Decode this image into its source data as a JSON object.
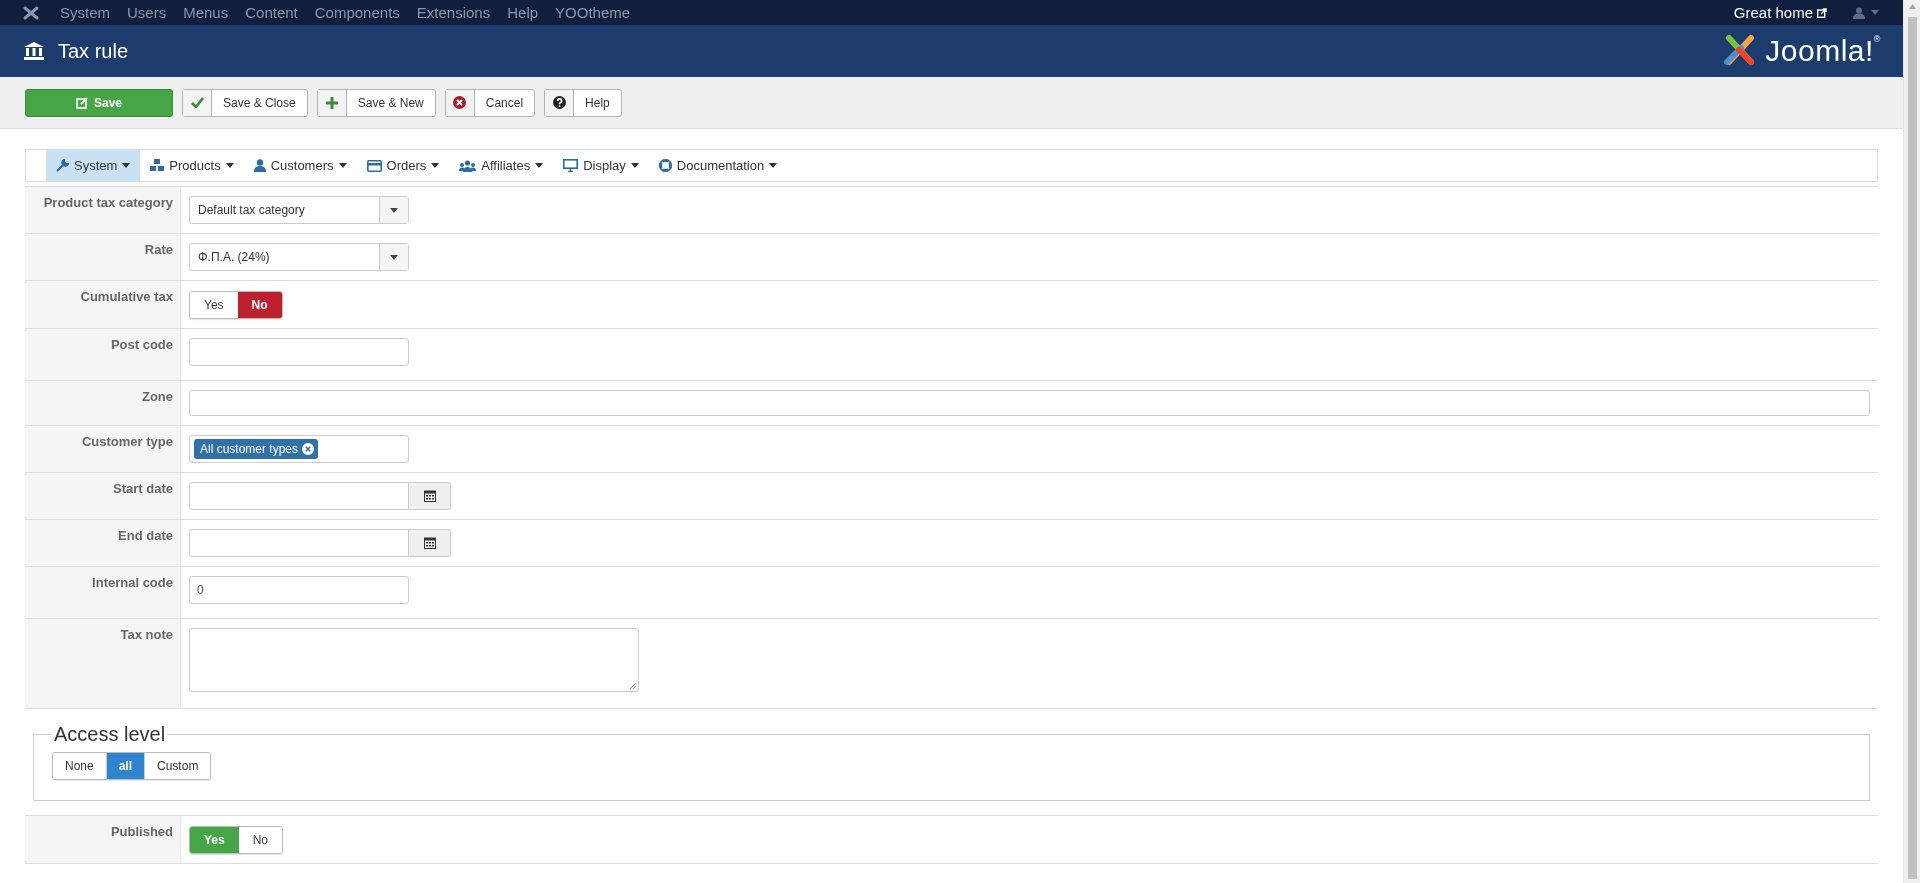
{
  "top_menu": {
    "items": [
      "System",
      "Users",
      "Menus",
      "Content",
      "Components",
      "Extensions",
      "Help",
      "YOOtheme"
    ],
    "site_link": "Great home"
  },
  "header": {
    "title": "Tax rule",
    "logo_text": "Joomla!$^{®}$"
  },
  "toolbar": {
    "buttons": [
      {
        "label": "Save",
        "kind": "primary"
      },
      {
        "label": "Save & Close",
        "kind": "check"
      },
      {
        "label": "Save & New",
        "kind": "plus"
      },
      {
        "label": "Cancel",
        "kind": "cancel"
      },
      {
        "label": "Help",
        "kind": "help"
      }
    ]
  },
  "submenu": {
    "items": [
      {
        "label": "System",
        "selected": true
      },
      {
        "label": "Products",
        "selected": false
      },
      {
        "label": "Customers",
        "selected": false
      },
      {
        "label": "Orders",
        "selected": false
      },
      {
        "label": "Affiliates",
        "selected": false
      },
      {
        "label": "Display",
        "selected": false
      },
      {
        "label": "Documentation",
        "selected": false
      }
    ]
  },
  "form": {
    "fields": [
      {
        "label": "Product tax category",
        "kind": "select",
        "value": "Default tax category"
      },
      {
        "label": "Rate",
        "kind": "select",
        "value": "Φ.Π.Α. (24%)"
      },
      {
        "label": "Cumulative tax",
        "kind": "toggle",
        "options": [
          {
            "label": "Yes",
            "selected": false
          },
          {
            "label": "No",
            "selected": true
          }
        ]
      },
      {
        "label": "Post code",
        "kind": "text"
      },
      {
        "label": "Zone",
        "kind": "multiselect"
      },
      {
        "label": "Customer type",
        "kind": "tags",
        "tags": [
          "All customer types"
        ]
      },
      {
        "label": "Start date",
        "kind": "date"
      },
      {
        "label": "End date",
        "kind": "date"
      },
      {
        "label": "Internal code",
        "kind": "text",
        "value": "0"
      },
      {
        "label": "Tax note",
        "kind": "textarea"
      }
    ]
  },
  "access_level": {
    "legend": "Access level",
    "options": [
      {
        "label": "None",
        "selected": false
      },
      {
        "label": "all",
        "selected": true
      },
      {
        "label": "Custom",
        "selected": false
      }
    ]
  },
  "published": {
    "label": "Published",
    "kind": "toggle",
    "options": [
      {
        "label": "Yes",
        "selected": true
      },
      {
        "label": "No",
        "selected": false
      }
    ]
  }
}
